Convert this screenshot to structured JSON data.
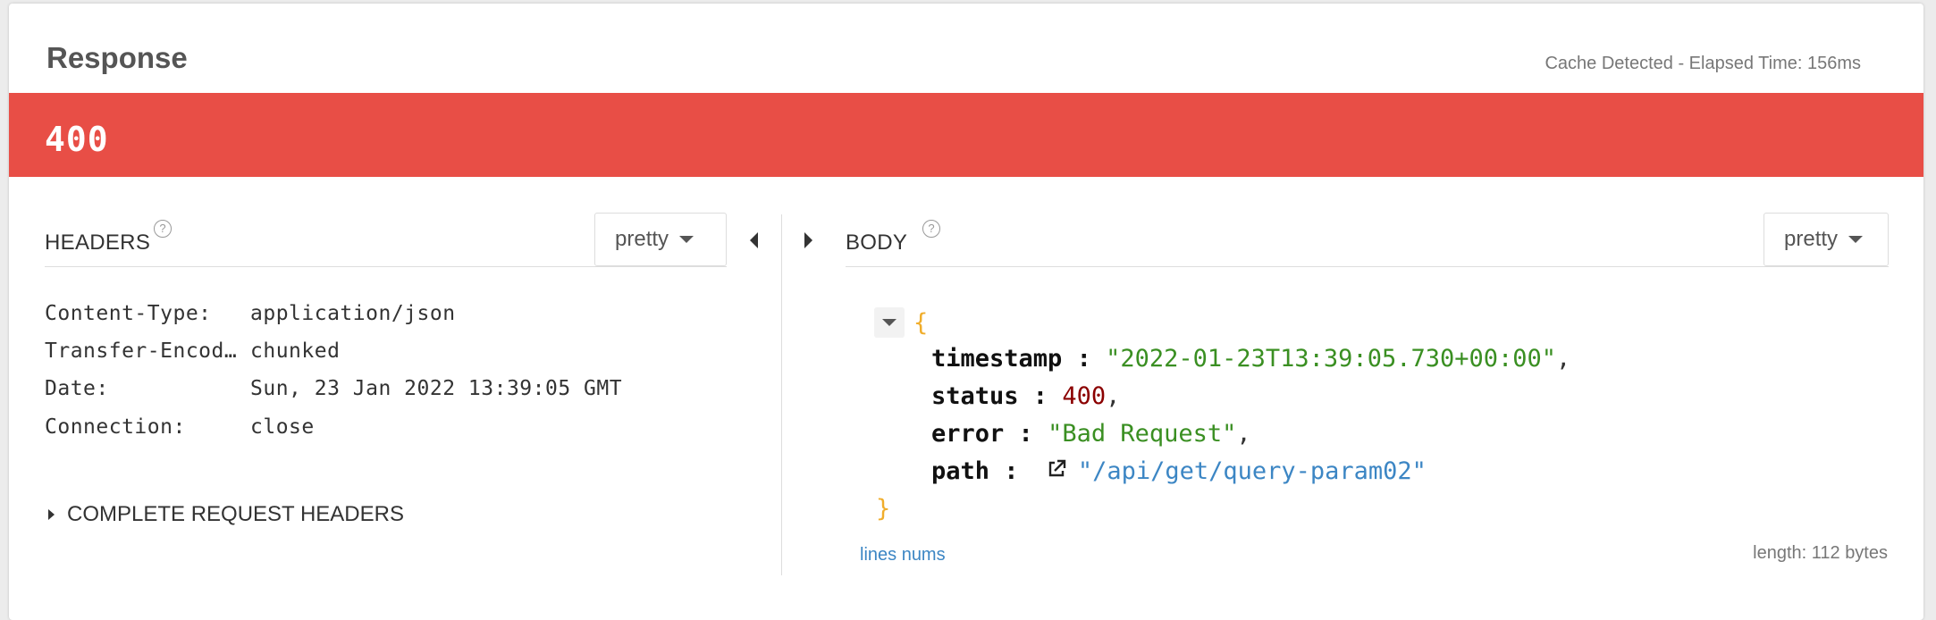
{
  "panel": {
    "title": "Response",
    "meta": "Cache Detected - Elapsed Time: 156ms",
    "status_code": "400",
    "status_color": "#e84e46"
  },
  "headers": {
    "label": "HEADERS",
    "help_icon": "question-circle-icon",
    "format": "pretty",
    "rows": [
      {
        "key": "Content-Type:",
        "value": "application/json"
      },
      {
        "key": "Transfer-Encod…",
        "value": "chunked"
      },
      {
        "key": "Date:",
        "value": "Sun, 23 Jan 2022 13:39:05 GMT"
      },
      {
        "key": "Connection:",
        "value": "close"
      }
    ],
    "complete_label": "COMPLETE REQUEST HEADERS"
  },
  "body": {
    "label": "BODY",
    "help_icon": "question-circle-icon",
    "format": "pretty",
    "open_brace": "{",
    "close_brace": "}",
    "fields": [
      {
        "key": "timestamp",
        "sep": " : ",
        "value": "\"2022-01-23T13:39:05.730+00:00\"",
        "trail": ","
      },
      {
        "key": "status",
        "sep": " : ",
        "value": "400",
        "trail": ","
      },
      {
        "key": "error",
        "sep": " : ",
        "value": "\"Bad Request\"",
        "trail": ","
      },
      {
        "key": "path",
        "sep": " : ",
        "value": "\"/api/get/query-param02\"",
        "trail": ""
      }
    ],
    "lines_nums": "lines nums",
    "length": "length: 112 bytes"
  },
  "colors": {
    "string": "#3a8f22",
    "number": "#8b0000",
    "link": "#3c86c4",
    "brace": "#f0ad2b"
  }
}
